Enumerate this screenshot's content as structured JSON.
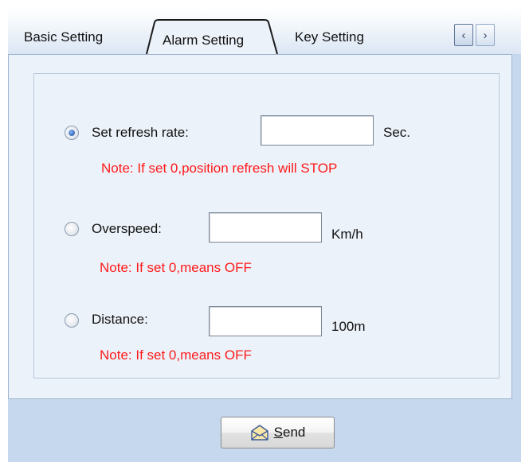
{
  "tabs": {
    "basic": "Basic Setting",
    "alarm": "Alarm Setting",
    "key": "Key Setting"
  },
  "nav": {
    "prev_icon": "chevron-left-icon",
    "next_icon": "chevron-right-icon"
  },
  "options": [
    {
      "label": "Set refresh rate:",
      "value": "",
      "unit": "Sec.",
      "note": "Note: If set 0,position refresh will STOP",
      "checked": true
    },
    {
      "label": "Overspeed:",
      "value": "",
      "unit": "Km/h",
      "note": "Note: If set 0,means OFF",
      "checked": false
    },
    {
      "label": "Distance:",
      "value": "",
      "unit": "100m",
      "note": "Note: If set 0,means OFF",
      "checked": false
    }
  ],
  "send": {
    "mnemonic": "S",
    "rest": "end",
    "icon": "envelope-icon"
  },
  "colors": {
    "note": "#ff1a1a",
    "panel": "#ecf2f9",
    "frame": "#c6d8ee"
  }
}
